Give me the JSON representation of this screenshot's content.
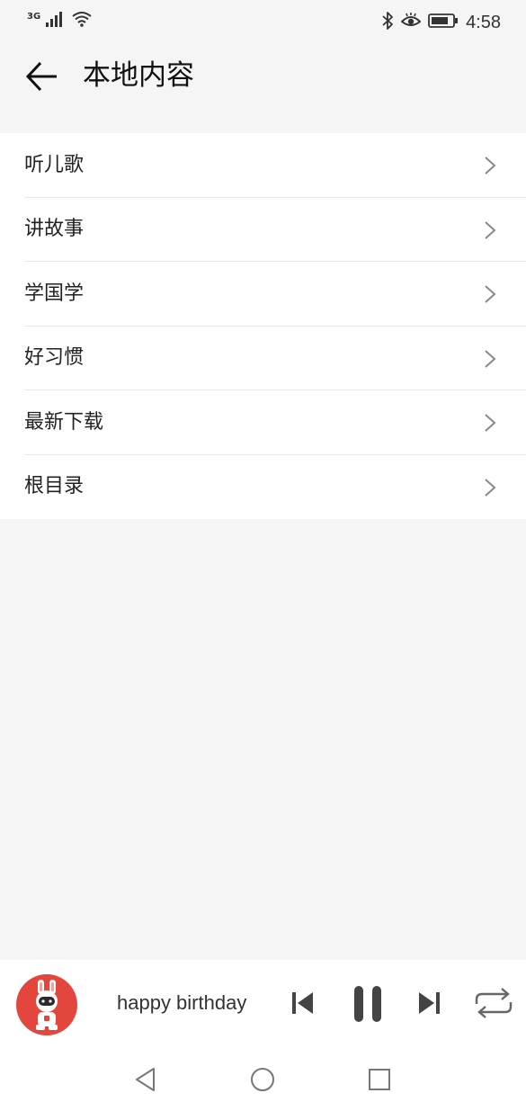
{
  "status_bar": {
    "network_type": "3G",
    "time": "4:58",
    "icons": [
      "signal-icon",
      "wifi-icon",
      "bluetooth-icon",
      "eye-comfort-icon",
      "battery-icon"
    ]
  },
  "header": {
    "title": "本地内容",
    "back_icon": "arrow-left-icon"
  },
  "list": {
    "items": [
      {
        "label": "听儿歌"
      },
      {
        "label": "讲故事"
      },
      {
        "label": "学国学"
      },
      {
        "label": "好习惯"
      },
      {
        "label": "最新下载"
      },
      {
        "label": "根目录"
      }
    ],
    "chevron_icon": "chevron-right-icon"
  },
  "player": {
    "track_title": "happy birthday",
    "avatar_icon": "robot-bunny-avatar",
    "accent_color": "#e3463d",
    "controls": [
      "skip-previous-icon",
      "pause-icon",
      "skip-next-icon",
      "repeat-icon"
    ]
  },
  "navbar": {
    "buttons": [
      "nav-back-icon",
      "nav-home-icon",
      "nav-recents-icon"
    ]
  }
}
